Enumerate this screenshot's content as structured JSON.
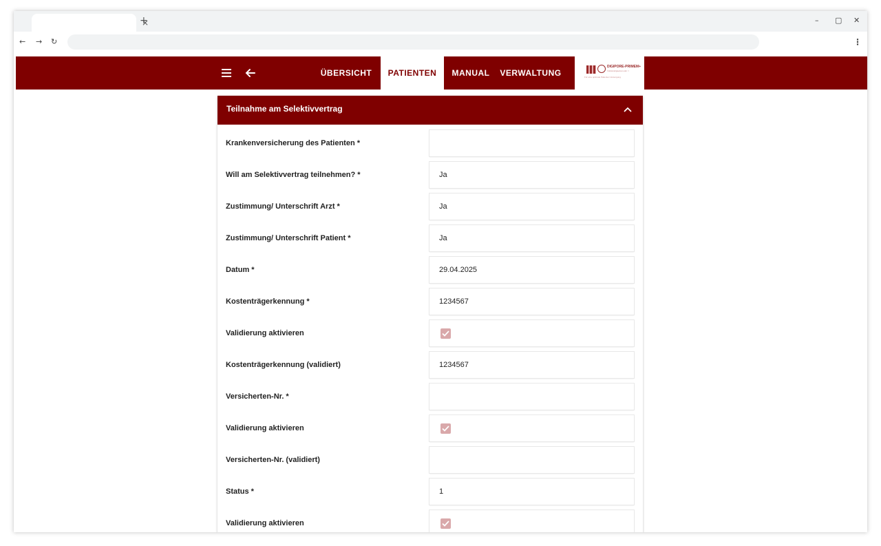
{
  "browser": {
    "tab_close": "×",
    "new_tab": "+",
    "window_controls": [
      "–",
      "▢",
      "✕"
    ],
    "nav": {
      "back": "←",
      "forward": "→",
      "reload": "↻"
    },
    "menu": "⋮"
  },
  "header": {
    "nav_items": [
      "ÜBERSICHT",
      "PATIENTEN",
      "MANUAL",
      "VERWALTUNG"
    ],
    "active_nav": "PATIENTEN",
    "logo": {
      "text": "DIGIPORE-PRIMEM+",
      "sub": "Vollständigkeitsmodul ☆",
      "sub2": "Für eine optimale Patienten Versorgung"
    }
  },
  "section": {
    "title": "Teilnahme am Selektivvertrag",
    "fields": [
      {
        "label": "Krankenversicherung des Patienten *",
        "type": "text",
        "value": ""
      },
      {
        "label": "Will am Selektivvertrag teilnehmen? *",
        "type": "text",
        "value": "Ja"
      },
      {
        "label": "Zustimmung/ Unterschrift Arzt *",
        "type": "text",
        "value": "Ja"
      },
      {
        "label": "Zustimmung/ Unterschrift Patient *",
        "type": "text",
        "value": "Ja"
      },
      {
        "label": "Datum *",
        "type": "text",
        "value": "29.04.2025"
      },
      {
        "label": "Kostenträgerkennung *",
        "type": "text",
        "value": "1234567"
      },
      {
        "label": "Validierung aktivieren",
        "type": "checkbox",
        "checked": true
      },
      {
        "label": "Kostenträgerkennung (validiert)",
        "type": "text",
        "value": "1234567"
      },
      {
        "label": "Versicherten-Nr. *",
        "type": "text",
        "value": ""
      },
      {
        "label": "Validierung aktivieren",
        "type": "checkbox",
        "checked": true
      },
      {
        "label": "Versicherten-Nr. (validiert)",
        "type": "text",
        "value": ""
      },
      {
        "label": "Status *",
        "type": "text",
        "value": "1"
      },
      {
        "label": "Validierung aktivieren",
        "type": "checkbox",
        "checked": true
      }
    ]
  },
  "colors": {
    "brand": "#7f0000",
    "checkbox_disabled": "#d9a8aa"
  }
}
